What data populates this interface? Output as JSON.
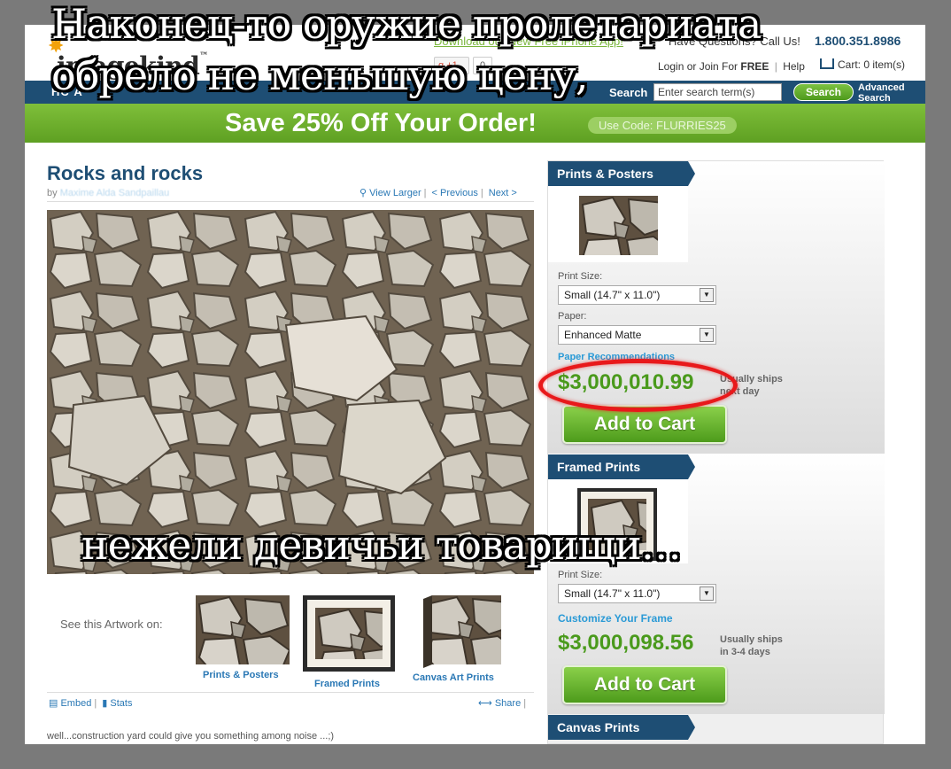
{
  "meme": {
    "top_line1": "Наконец-то оружие пролетариата",
    "top_line2": "обрело не меньшую цену,",
    "bottom_line": "нежели девичьи товарищи…"
  },
  "header": {
    "logo_text": "imagekind",
    "logo_tm": "™",
    "app_link": "Download our New Free iPhone App!",
    "questions": "Have Questions? Call Us!",
    "phone": "1.800.351.8986",
    "gplus_label": "+1",
    "gplus_count": "0",
    "login_text": "Login or Join For",
    "login_free": "FREE",
    "help": "Help",
    "cart": "Cart: 0 item(s)"
  },
  "nav": {
    "items_visible": "НС  A",
    "search_label": "Search",
    "search_placeholder": "Enter search term(s)",
    "search_button": "Search",
    "advanced_line1": "Advanced",
    "advanced_line2": "Search"
  },
  "promo": {
    "text": "Save 25% Off Your Order!",
    "code": "Use Code: FLURRIES25"
  },
  "artwork": {
    "title": "Rocks and rocks",
    "by": "by",
    "artist": "Maxime Alda Sandpaillau",
    "view_larger": "View Larger",
    "previous": "< Previous",
    "next": "Next >",
    "see_on": "See this Artwork on:",
    "thumbs": [
      "Prints & Posters",
      "Framed Prints",
      "Canvas Art Prints"
    ],
    "embed": "Embed",
    "stats": "Stats",
    "share": "Share",
    "comment": "well...construction yard could give you something among noise ...;)"
  },
  "prints_posters": {
    "header": "Prints & Posters",
    "print_size_label": "Print Size:",
    "print_size_value": "Small (14.7\" x 11.0\")",
    "paper_label": "Paper:",
    "paper_value": "Enhanced Matte",
    "paper_recommend": "Paper Recommendations",
    "price": "$3,000,010.99",
    "ship_line1": "Usually ships",
    "ship_line2": "next day",
    "add_to_cart": "Add to Cart"
  },
  "framed_prints": {
    "header": "Framed Prints",
    "print_size_label": "Print Size:",
    "print_size_value": "Small (14.7\" x 11.0\")",
    "customize": "Customize Your Frame",
    "price": "$3,000,098.56",
    "ship_line1": "Usually ships",
    "ship_line2": "in 3-4 days",
    "add_to_cart": "Add to Cart"
  },
  "canvas_prints": {
    "header": "Canvas Prints"
  },
  "colors": {
    "brand_blue": "#1e4e74",
    "brand_green": "#4a9a1c",
    "link_blue": "#2a78b5",
    "highlight_red": "#e8191b"
  }
}
